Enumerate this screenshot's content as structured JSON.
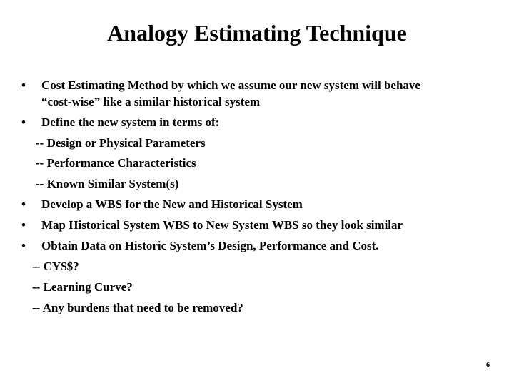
{
  "slide": {
    "title": "Analogy Estimating Technique",
    "bullet_glyph": "•",
    "items": [
      {
        "type": "bullet",
        "text": "Cost Estimating Method by which we assume our new system will behave"
      },
      {
        "type": "continuation",
        "text": "“cost-wise” like a similar historical system"
      },
      {
        "type": "bullet",
        "text": "Define the new system in terms of:"
      },
      {
        "type": "sub",
        "text": "-- Design or Physical Parameters"
      },
      {
        "type": "sub",
        "text": "-- Performance Characteristics"
      },
      {
        "type": "sub",
        "text": "-- Known Similar System(s)"
      },
      {
        "type": "bullet",
        "text": "Develop a WBS for the New and Historical System"
      },
      {
        "type": "bullet",
        "text": "Map Historical System WBS to New System WBS so they look similar"
      },
      {
        "type": "bullet",
        "text": "Obtain Data on Historic System’s Design, Performance and Cost."
      },
      {
        "type": "sub",
        "text": "--  CY$$?"
      },
      {
        "type": "sub",
        "text": "--  Learning Curve?"
      },
      {
        "type": "sub",
        "text": "--  Any burdens that need to be removed?"
      }
    ],
    "page_number": "6"
  }
}
